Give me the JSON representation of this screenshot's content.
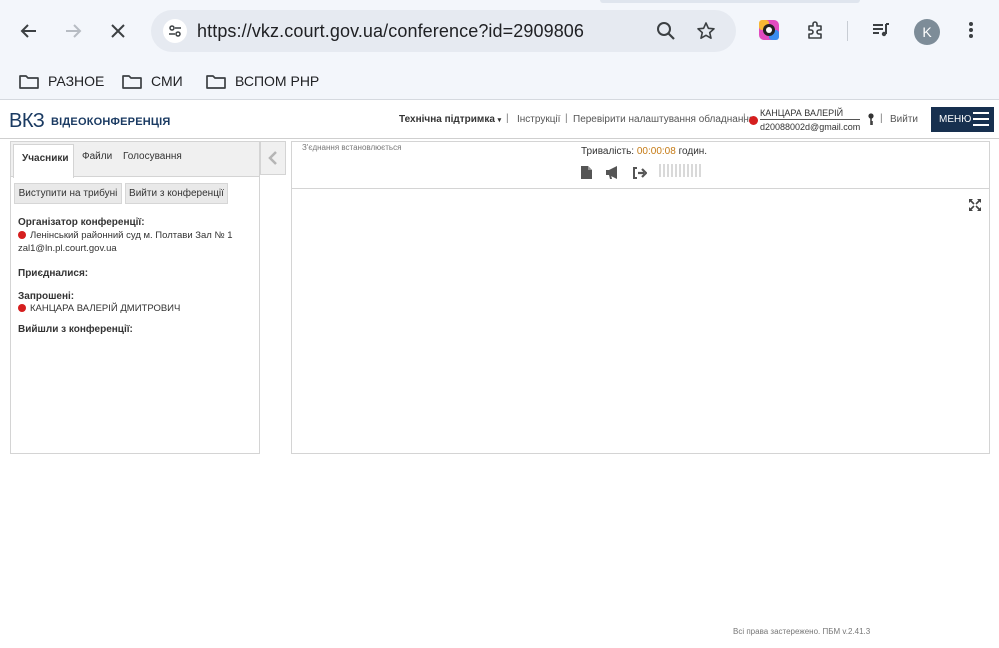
{
  "browser": {
    "url": "https://vkz.court.gov.ua/conference?id=2909806",
    "profile_initial": "K",
    "bookmarks": [
      {
        "label": "РАЗНОЕ"
      },
      {
        "label": "СМИ"
      },
      {
        "label": "ВСПОМ PHP"
      }
    ]
  },
  "app": {
    "logo": "ВКЗ",
    "logo_sub": "ВІДЕОКОНФЕРЕНЦІЯ",
    "support": "Технічна підтримка",
    "instructions": "Інструкції",
    "check_equipment": "Перевірити налаштування обладнання",
    "user_name": "КАНЦАРА ВАЛЕРІЙ",
    "user_email": "d20088002d@gmail.com",
    "logout": "Вийти",
    "menu": "МЕНЮ"
  },
  "left_panel": {
    "tabs": [
      "Учасники",
      "Файли",
      "Голосування"
    ],
    "btn_tribune": "Виступити на трибуні",
    "btn_leave": "Вийти з конференції",
    "organizer_label": "Організатор конференції:",
    "organizer_name": "Ленінський районний суд м. Полтави Зал № 1",
    "organizer_email": "zal1@ln.pl.court.gov.ua",
    "joined_label": "Приєдналися:",
    "invited_label": "Запрошені:",
    "invited_name": "КАНЦАРА ВАЛЕРІЙ ДМИТРОВИЧ",
    "left_label": "Вийшли з конференції:"
  },
  "right_panel": {
    "connection_status": "З'єднання встановлюється",
    "duration_label": "Тривалість:",
    "duration_value": "00:00:08",
    "duration_unit": "годин."
  },
  "footer": "Всі права застережено. ПБМ v.2.41.3",
  "colors": {
    "accent": "#17304f",
    "status_red": "#d51e1e",
    "timer": "#c57a14"
  }
}
